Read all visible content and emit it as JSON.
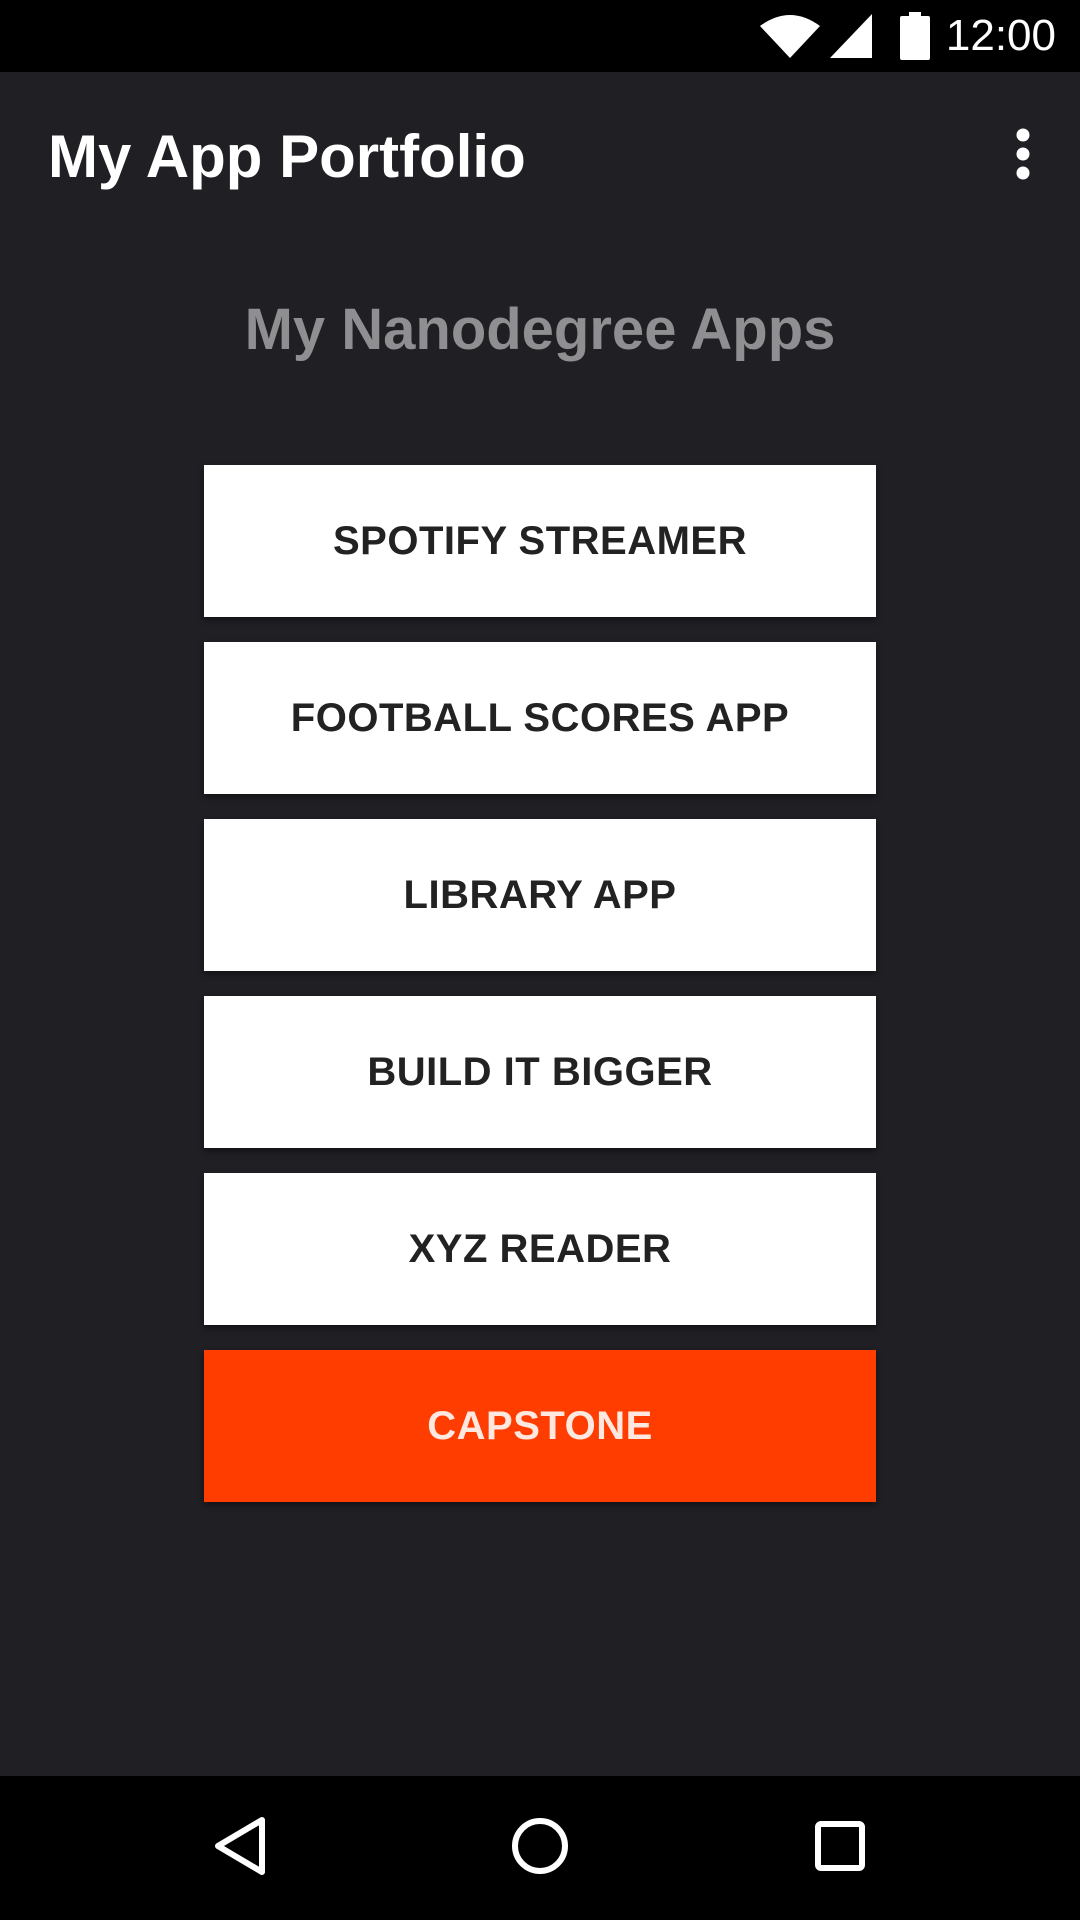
{
  "status_bar": {
    "time": "12:00",
    "icons": [
      "wifi-icon",
      "signal-icon",
      "battery-icon"
    ]
  },
  "app_bar": {
    "title": "My App Portfolio",
    "overflow_icon": "more-vert-icon"
  },
  "main": {
    "heading": "My Nanodegree Apps",
    "buttons": [
      {
        "label": "SPOTIFY STREAMER"
      },
      {
        "label": "FOOTBALL SCORES APP"
      },
      {
        "label": "LIBRARY APP"
      },
      {
        "label": "BUILD IT BIGGER"
      },
      {
        "label": "XYZ READER"
      },
      {
        "label": "CAPSTONE"
      }
    ]
  },
  "nav_bar": {
    "icons": [
      "back-icon",
      "home-icon",
      "recents-icon"
    ]
  },
  "colors": {
    "background": "#201f24",
    "bars": "#000000",
    "button": "#ffffff",
    "accent": "#ff3d00",
    "heading": "#8f8f92"
  }
}
